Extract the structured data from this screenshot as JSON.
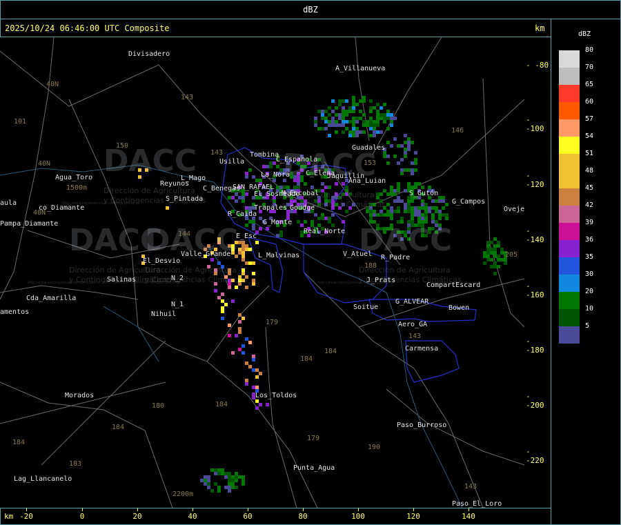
{
  "title": "dBZ",
  "timestamp": "2025/10/24 06:46:00 UTC Composite",
  "axis_unit": "km",
  "right_ticks": [
    "-80",
    "-100",
    "-120",
    "-140",
    "-160",
    "-180",
    "-200",
    "-220"
  ],
  "bottom_ticks": [
    "-20",
    "0",
    "20",
    "40",
    "60",
    "80",
    "100",
    "120",
    "140"
  ],
  "legend": {
    "title": "dBZ",
    "entries": [
      {
        "label": "80",
        "color": "#d9d9d9"
      },
      {
        "label": "70",
        "color": "#bdbdbd"
      },
      {
        "label": "65",
        "color": "#ff3a2a"
      },
      {
        "label": "60",
        "color": "#ff5a00"
      },
      {
        "label": "57",
        "color": "#ff9966"
      },
      {
        "label": "54",
        "color": "#ffff22"
      },
      {
        "label": "51",
        "color": "#f0c030"
      },
      {
        "label": "48",
        "color": "#f0c030"
      },
      {
        "label": "45",
        "color": "#cc8040"
      },
      {
        "label": "42",
        "color": "#cc6699"
      },
      {
        "label": "39",
        "color": "#cc1199"
      },
      {
        "label": "36",
        "color": "#8822cc"
      },
      {
        "label": "35",
        "color": "#2255dd"
      },
      {
        "label": "30",
        "color": "#1188dd"
      },
      {
        "label": "20",
        "color": "#007700"
      },
      {
        "label": "10",
        "color": "#005500"
      },
      {
        "label": "5",
        "color": "#4a4a99"
      }
    ]
  },
  "watermark": {
    "logo_text": "DACC",
    "line1": "Dirección de Agricultura",
    "line2": "y Contingencias Climáticas",
    "url": "http://www.contingencias.mendoza.gov.ar"
  },
  "places": [
    {
      "name": "Divisadero"
    },
    {
      "name": "A_Villanueva"
    },
    {
      "name": "Guadales"
    },
    {
      "name": "Tombina"
    },
    {
      "name": "Usilla"
    },
    {
      "name": "C_Espanola"
    },
    {
      "name": "La_Nora"
    },
    {
      "name": "C_Elena"
    },
    {
      "name": "Jaquillin"
    },
    {
      "name": "Ana_Luian"
    },
    {
      "name": "S_Gutón"
    },
    {
      "name": "G_Campos"
    },
    {
      "name": "Oveje"
    },
    {
      "name": "Agua_Toro"
    },
    {
      "name": "Reyunos"
    },
    {
      "name": "L_Mago"
    },
    {
      "name": "S_Pintada"
    },
    {
      "name": "C_Benegas"
    },
    {
      "name": "SAN_RAFAEL"
    },
    {
      "name": "El_Sosneado"
    },
    {
      "name": "M_Escobal"
    },
    {
      "name": "Trapales"
    },
    {
      "name": "Goudge"
    },
    {
      "name": "R_Caida"
    },
    {
      "name": "G_Monte"
    },
    {
      "name": "Real_Norte"
    },
    {
      "name": "E_Esc"
    },
    {
      "name": "Valle_Grande"
    },
    {
      "name": "L_Malvinas"
    },
    {
      "name": "El_Desvio"
    },
    {
      "name": "V_Atuel"
    },
    {
      "name": "R_Padre"
    },
    {
      "name": "J_Prats"
    },
    {
      "name": "CompartEscard"
    },
    {
      "name": "G_ALVEAR"
    },
    {
      "name": "Bowen"
    },
    {
      "name": "Soitue"
    },
    {
      "name": "Aero_GA"
    },
    {
      "name": "Carmensa"
    },
    {
      "name": "Salinas"
    },
    {
      "name": "N_2"
    },
    {
      "name": "N_1"
    },
    {
      "name": "Nihuil"
    },
    {
      "name": "Cda_Amarilla"
    },
    {
      "name": "amentos"
    },
    {
      "name": "Pampa_Diamante"
    },
    {
      "name": "aula"
    },
    {
      "name": "Los_Toldos"
    },
    {
      "name": "Morados"
    },
    {
      "name": "Paso_Burroso"
    },
    {
      "name": "Punta_Agua"
    },
    {
      "name": "Lag_Llancanelo"
    },
    {
      "name": "Paso_El_Loro"
    },
    {
      "name": "co_Diamante"
    }
  ],
  "road_numbers": [
    "143",
    "146",
    "101",
    "40N",
    "40N",
    "40N",
    "150",
    "143",
    "184",
    "179",
    "184",
    "180",
    "184",
    "184",
    "183",
    "179",
    "190",
    "143",
    "143",
    "205",
    "1500m",
    "2200m",
    "153",
    "144",
    "188",
    "184"
  ]
}
